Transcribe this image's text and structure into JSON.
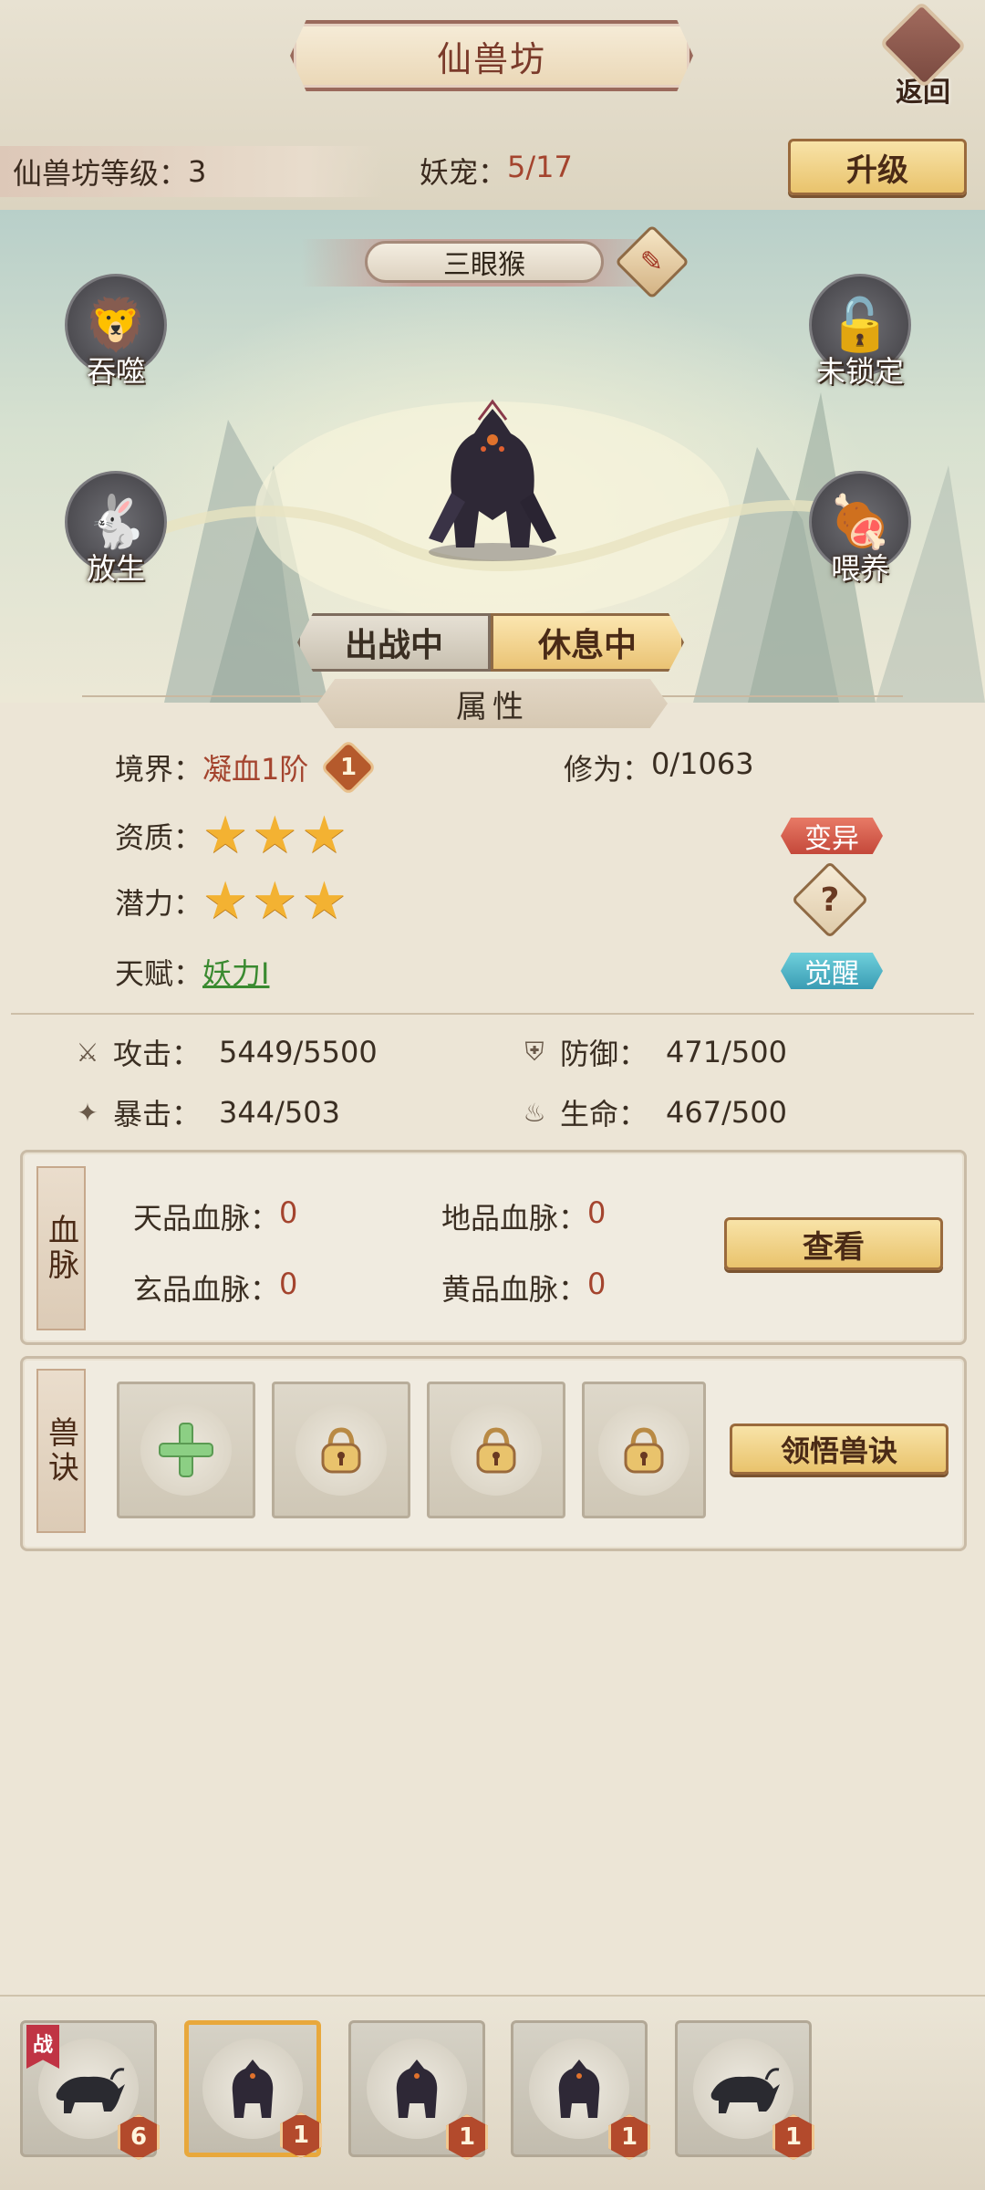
{
  "header": {
    "title": "仙兽坊",
    "back_label": "返回",
    "level_label": "仙兽坊等级：",
    "level_value": "3",
    "pet_count_label": "妖宠：",
    "pet_count_value": "5/17",
    "upgrade_label": "升级"
  },
  "pet": {
    "name": "三眼猴",
    "rename_icon": "brush-icon"
  },
  "side_actions": {
    "devour": "吞噬",
    "lock": "未锁定",
    "release": "放生",
    "feed": "喂养"
  },
  "tabs": {
    "fighting": "出战中",
    "resting": "休息中",
    "active": "resting"
  },
  "attributes": {
    "header": "属性",
    "realm_label": "境界：",
    "realm_value": "凝血1阶",
    "realm_badge": "1",
    "cultivation_label": "修为：",
    "cultivation_value": "0/1063",
    "aptitude_label": "资质：",
    "aptitude_stars": 3,
    "potential_label": "潜力：",
    "potential_stars": 3,
    "talent_label": "天赋：",
    "talent_value": "妖力Ⅰ",
    "mutate_label": "变异",
    "help_label": "?",
    "awaken_label": "觉醒"
  },
  "stats": {
    "atk_label": "攻击：",
    "atk_value": "5449/5500",
    "def_label": "防御：",
    "def_value": "471/500",
    "crit_label": "暴击：",
    "crit_value": "344/503",
    "hp_label": "生命：",
    "hp_value": "467/500"
  },
  "bloodline": {
    "tag": "血脉",
    "heaven_label": "天品血脉：",
    "heaven_value": "0",
    "earth_label": "地品血脉：",
    "earth_value": "0",
    "mystic_label": "玄品血脉：",
    "mystic_value": "0",
    "yellow_label": "黄品血脉：",
    "yellow_value": "0",
    "view_label": "查看"
  },
  "skills": {
    "tag": "兽诀",
    "learn_label": "领悟兽诀"
  },
  "pet_list": [
    {
      "level": "6",
      "battle": "战",
      "kind": "ox"
    },
    {
      "level": "1",
      "kind": "monkey",
      "selected": true
    },
    {
      "level": "1",
      "kind": "monkey"
    },
    {
      "level": "1",
      "kind": "monkey"
    },
    {
      "level": "1",
      "kind": "ox"
    }
  ],
  "colors": {
    "accent_red": "#a4442e",
    "gold": "#e9c36c",
    "talent_green": "#3a8a30"
  }
}
